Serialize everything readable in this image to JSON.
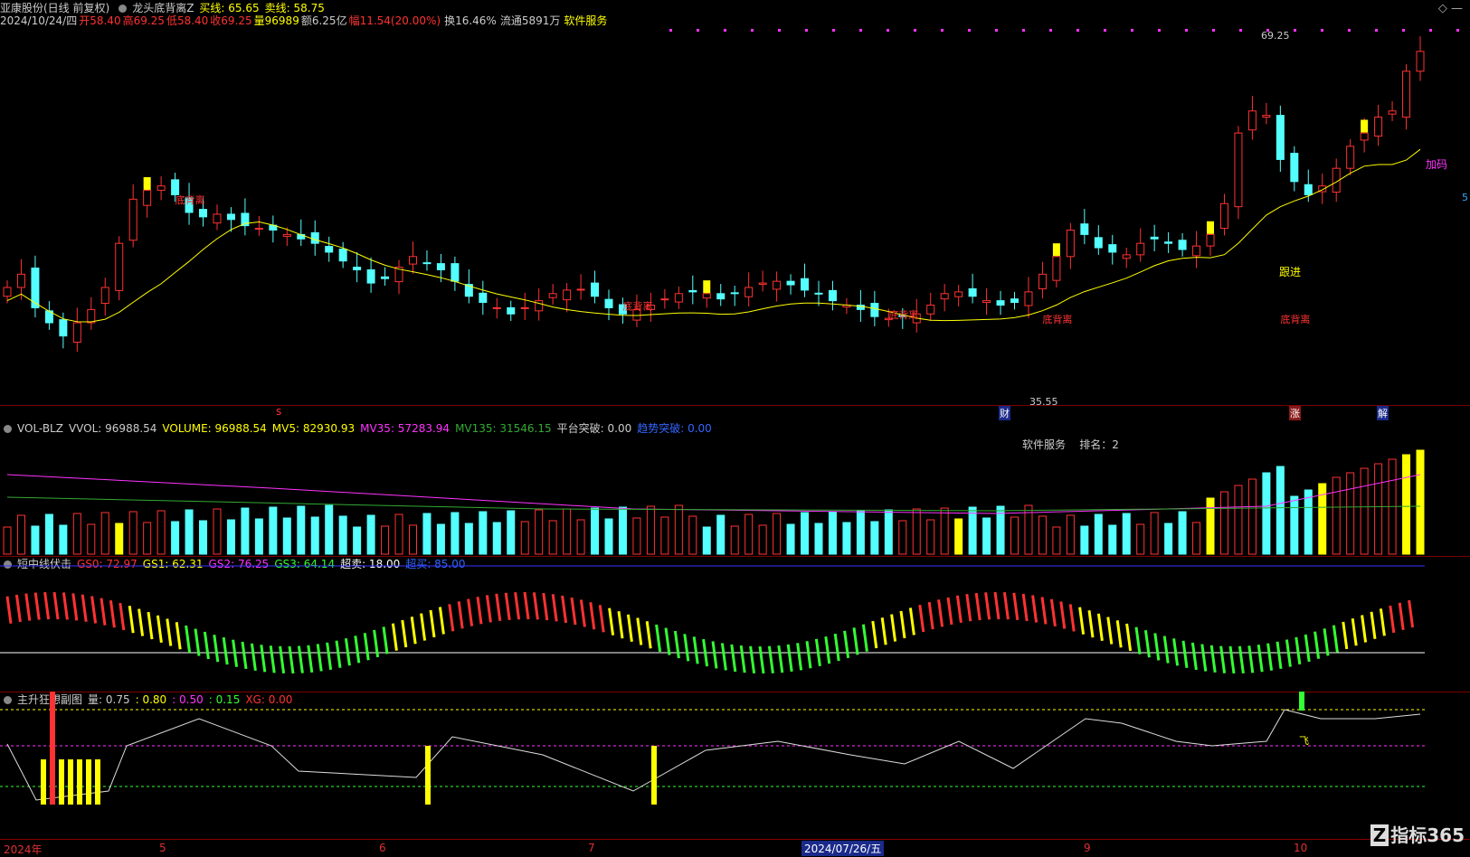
{
  "main": {
    "title": "亚康股份(日线 前复权)",
    "date": "2024/10/24/四",
    "open": "开58.40",
    "high": "高69.25",
    "low": "低58.40",
    "close": "收69.25",
    "volume": "量96989",
    "amount": "额6.25亿",
    "change": "幅11.54(20.00%)",
    "turnover": "换16.46%",
    "float": "流通5891万",
    "sector": "软件服务",
    "indicator_name": "龙头底背离Z",
    "buy_line": "买线: 65.65",
    "sell_line": "卖线: 58.75",
    "max_price": "69.25",
    "min_price": "35.55",
    "labels": {
      "dibeili": "底背离",
      "gen_jin": "跟进",
      "jia_ma": "加码",
      "cai": "财",
      "zhang": "涨",
      "jie": "解",
      "s": "s",
      "right": "5"
    }
  },
  "vol": {
    "name": "VOL-BLZ",
    "vvol": "VVOL: 96988.54",
    "volume": "VOLUME: 96988.54",
    "mv5": "MV5: 82930.93",
    "mv35": "MV35: 57283.94",
    "mv135": "MV135: 31546.15",
    "platform": "平台突破: 0.00",
    "trend": "趋势突破: 0.00",
    "sector_label": "软件服务",
    "rank": "排名：2"
  },
  "osc": {
    "name": "短中线伏击",
    "gs0": "GS0: 72.97",
    "gs1": "GS1: 62.31",
    "gs2": "GS2: 76.25",
    "gs3": "GS3: 64.14",
    "oversell": "超卖: 18.00",
    "overbuy": "超买: 85.00"
  },
  "sub": {
    "name": "主升狂想副图",
    "liang": "量: 0.75",
    "v1": ": 0.80",
    "v2": ": 0.50",
    "v3": ": 0.15",
    "xg": "XG: 0.00",
    "fly": "飞"
  },
  "axis": {
    "labels": [
      "2024年",
      "5",
      "6",
      "7",
      "2024/07/26/五",
      "9",
      "10"
    ]
  },
  "brand": "指标365",
  "colors": {
    "up": "#ff3232",
    "down": "#54ffff",
    "yellow": "#ffff00",
    "magenta": "#ff33ff",
    "green": "#33ff33"
  },
  "chart_data": {
    "type": "candlestick",
    "close": [
      42.5,
      44.0,
      40.2,
      38.5,
      37.0,
      38.5,
      40.0,
      42.5,
      47.5,
      52.5,
      53.5,
      54.0,
      53.0,
      51.0,
      50.5,
      50.8,
      50.2,
      49.5,
      49.2,
      49.0,
      48.5,
      48.0,
      47.5,
      46.5,
      45.5,
      44.5,
      43.0,
      43.5,
      44.8,
      46.0,
      45.2,
      44.5,
      43.2,
      41.5,
      40.8,
      40.2,
      39.5,
      40.2,
      41.0,
      41.8,
      42.2,
      42.3,
      41.5,
      40.2,
      39.5,
      40.0,
      40.5,
      41.2,
      41.8,
      42.0,
      41.8,
      41.2,
      41.8,
      42.5,
      43.0,
      43.2,
      42.8,
      42.2,
      41.8,
      41.0,
      40.5,
      40.0,
      39.2,
      39.0,
      39.2,
      39.5,
      40.5,
      41.8,
      42.0,
      41.5,
      41.0,
      40.5,
      40.8,
      42.0,
      44.0,
      46.0,
      49.0,
      48.5,
      47.0,
      46.5,
      46.2,
      47.5,
      48.0,
      47.5,
      46.8,
      47.2,
      48.5,
      52.0,
      60.0,
      62.5,
      62.0,
      57.0,
      54.5,
      53.0,
      54.0,
      56.0,
      58.5,
      60.0,
      61.8,
      62.5,
      67.0,
      69.25
    ]
  }
}
